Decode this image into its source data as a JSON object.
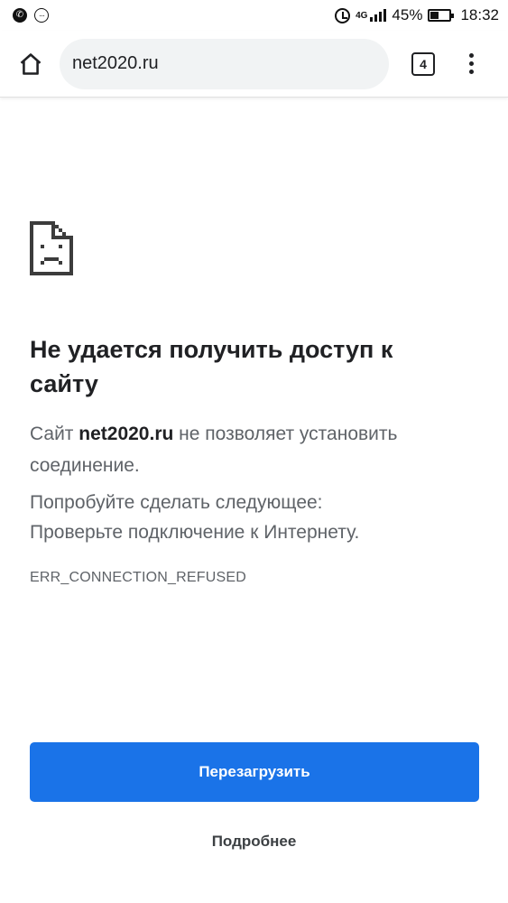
{
  "status_bar": {
    "network": "4G",
    "battery_percent": "45%",
    "battery_level": 0.45,
    "time": "18:32",
    "icons": [
      "viber-icon",
      "messages-icon",
      "alarm-icon",
      "signal-icon",
      "battery-icon"
    ]
  },
  "toolbar": {
    "url": "net2020.ru",
    "tab_count": "4",
    "icons": [
      "home-icon",
      "tabs-icon",
      "more-vert-icon"
    ]
  },
  "error": {
    "icon": "sad-page-icon",
    "title": "Не удается получить доступ к сайту",
    "desc_prefix": "Сайт ",
    "desc_host": "net2020.ru",
    "desc_suffix": " не позволяет установить соединение.",
    "suggest_heading": "Попробуйте сделать следующее:",
    "suggest_item": "Проверьте подключение к Интернету.",
    "code": "ERR_CONNECTION_REFUSED"
  },
  "actions": {
    "reload_label": "Перезагрузить",
    "details_label": "Подробнее"
  },
  "colors": {
    "primary_button": "#1a73e8",
    "url_bar_bg": "#f1f3f4",
    "secondary_text": "#5f6368"
  }
}
